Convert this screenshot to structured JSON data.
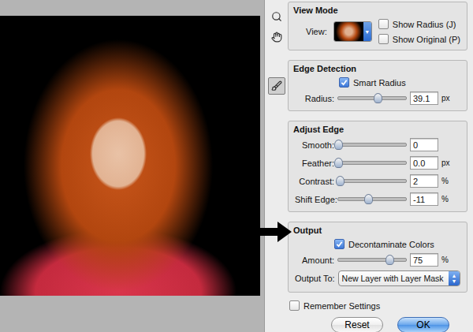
{
  "tools": [
    {
      "kind": "zoom",
      "selected": false
    },
    {
      "kind": "hand",
      "selected": false
    },
    {
      "kind": "refine-radius",
      "selected": true
    }
  ],
  "view_mode": {
    "title": "View Mode",
    "view_label": "View:",
    "options": [
      {
        "label": "Show Radius (J)",
        "checked": false
      },
      {
        "label": "Show Original (P)",
        "checked": false
      }
    ]
  },
  "edge_detection": {
    "title": "Edge Detection",
    "smart_radius": {
      "label": "Smart Radius",
      "checked": true
    },
    "radius": {
      "label": "Radius:",
      "value": "39.1",
      "unit": "px",
      "level": 0.58
    }
  },
  "adjust_edge": {
    "title": "Adjust Edge",
    "sliders": [
      {
        "label": "Smooth:",
        "value": "0",
        "unit": "",
        "level": 0
      },
      {
        "label": "Feather:",
        "value": "0.0",
        "unit": "px",
        "level": 0
      },
      {
        "label": "Contrast:",
        "value": "2",
        "unit": "%",
        "level": 0.02
      },
      {
        "label": "Shift Edge:",
        "value": "-11",
        "unit": "%",
        "level": 0.445
      }
    ]
  },
  "output": {
    "title": "Output",
    "decontaminate": {
      "label": "Decontaminate Colors",
      "checked": true
    },
    "amount": {
      "label": "Amount:",
      "value": "75",
      "unit": "%",
      "level": 0.75
    },
    "output_to": {
      "label": "Output To:",
      "value": "New Layer with Layer Mask"
    }
  },
  "remember_settings": {
    "label": "Remember Settings",
    "checked": false
  },
  "buttons": [
    {
      "label": "Reset",
      "default": false
    },
    {
      "label": "OK",
      "default": true
    }
  ]
}
